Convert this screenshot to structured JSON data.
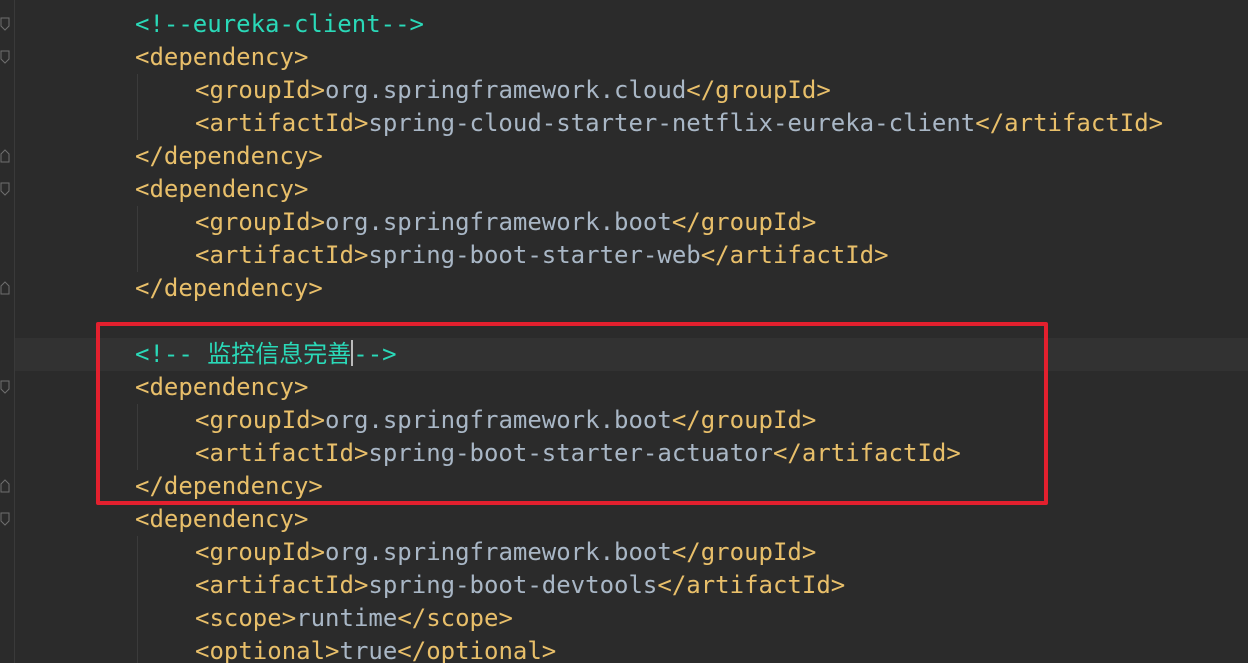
{
  "editor": {
    "lines": [
      {
        "indent": 0,
        "type": "comment",
        "text": "<!--eureka-client-->"
      },
      {
        "indent": 0,
        "type": "open",
        "tag": "dependency"
      },
      {
        "indent": 1,
        "type": "element",
        "tag": "groupId",
        "value": "org.springframework.cloud"
      },
      {
        "indent": 1,
        "type": "element",
        "tag": "artifactId",
        "value": "spring-cloud-starter-netflix-eureka-client"
      },
      {
        "indent": 0,
        "type": "close",
        "tag": "dependency"
      },
      {
        "indent": 0,
        "type": "open",
        "tag": "dependency"
      },
      {
        "indent": 1,
        "type": "element",
        "tag": "groupId",
        "value": "org.springframework.boot"
      },
      {
        "indent": 1,
        "type": "element",
        "tag": "artifactId",
        "value": "spring-boot-starter-web"
      },
      {
        "indent": 0,
        "type": "close",
        "tag": "dependency"
      },
      {
        "indent": 0,
        "type": "blank"
      },
      {
        "indent": 0,
        "type": "comment-caret",
        "before": "<!-- 监控信息完善",
        "after": "-->",
        "current": true
      },
      {
        "indent": 0,
        "type": "open",
        "tag": "dependency"
      },
      {
        "indent": 1,
        "type": "element",
        "tag": "groupId",
        "value": "org.springframework.boot"
      },
      {
        "indent": 1,
        "type": "element",
        "tag": "artifactId",
        "value": "spring-boot-starter-actuator"
      },
      {
        "indent": 0,
        "type": "close",
        "tag": "dependency"
      },
      {
        "indent": 0,
        "type": "open",
        "tag": "dependency"
      },
      {
        "indent": 1,
        "type": "element",
        "tag": "groupId",
        "value": "org.springframework.boot"
      },
      {
        "indent": 1,
        "type": "element",
        "tag": "artifactId",
        "value": "spring-boot-devtools"
      },
      {
        "indent": 1,
        "type": "element",
        "tag": "scope",
        "value": "runtime"
      },
      {
        "indent": 1,
        "type": "element",
        "tag": "optional",
        "value": "true"
      }
    ],
    "fold_icon": "fold-marker-icon"
  },
  "colors": {
    "background": "#2b2b2b",
    "tag": "#e8bf6a",
    "text": "#a9b7c6",
    "comment": "#2ad9b8",
    "highlight_box": "#e3202e"
  }
}
